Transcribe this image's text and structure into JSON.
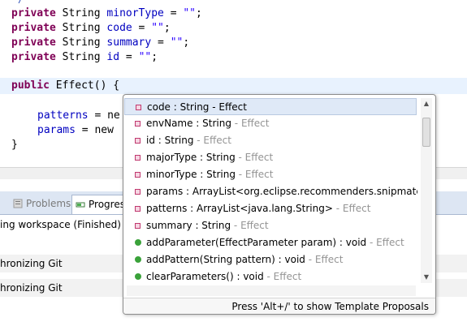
{
  "editor": {
    "fields": [
      {
        "kw": "private",
        "type": "String",
        "name": "minorType",
        "eq": " = ",
        "val": "\"\"",
        "end": ";"
      },
      {
        "kw": "private",
        "type": "String",
        "name": "code",
        "eq": " = ",
        "val": "\"\"",
        "end": ";"
      },
      {
        "kw": "private",
        "type": "String",
        "name": "summary",
        "eq": " = ",
        "val": "\"\"",
        "end": ";"
      },
      {
        "kw": "private",
        "type": "String",
        "name": "id",
        "eq": " = ",
        "val": "\"\"",
        "end": ";"
      }
    ],
    "constructor": {
      "kw": "public",
      "sig": "Effect() {"
    },
    "body": [
      {
        "name": "patterns",
        "rest": " = ne"
      },
      {
        "name": "params",
        "rest": " = new"
      }
    ],
    "closing": "}"
  },
  "views": {
    "tabs": [
      {
        "label": "Problems",
        "icon": "problems-icon"
      },
      {
        "label": "Progres",
        "icon": "progress-icon"
      }
    ],
    "rows": [
      "ing workspace (Finished)",
      "hronizing Git",
      "hronizing Git"
    ]
  },
  "popup": {
    "items": [
      {
        "icon": "field-icon",
        "main": "code : String - Effect",
        "owner": ""
      },
      {
        "icon": "field-icon",
        "main": "envName : String",
        "owner": " - Effect"
      },
      {
        "icon": "field-icon",
        "main": "id : String",
        "owner": " - Effect"
      },
      {
        "icon": "field-icon",
        "main": "majorType : String",
        "owner": " - Effect"
      },
      {
        "icon": "field-icon",
        "main": "minorType : String",
        "owner": " - Effect"
      },
      {
        "icon": "field-icon",
        "main": "params : ArrayList<org.eclipse.recommenders.snipmatch.",
        "owner": ""
      },
      {
        "icon": "field-icon",
        "main": "patterns : ArrayList<java.lang.String>",
        "owner": " - Effect"
      },
      {
        "icon": "field-icon",
        "main": "summary : String",
        "owner": " - Effect"
      },
      {
        "icon": "method-icon",
        "main": "addParameter(EffectParameter param) : void",
        "owner": " - Effect"
      },
      {
        "icon": "method-icon",
        "main": "addPattern(String pattern) : void",
        "owner": " - Effect"
      },
      {
        "icon": "method-icon",
        "main": "clearParameters() : void",
        "owner": " - Effect"
      }
    ],
    "selected_index": 0,
    "status_text": "Press 'Alt+/' to show Template Proposals"
  },
  "colors": {
    "keyword": "#7f0055",
    "field": "#0000c0",
    "string": "#2a00ff",
    "selection": "#dfe9f7"
  }
}
